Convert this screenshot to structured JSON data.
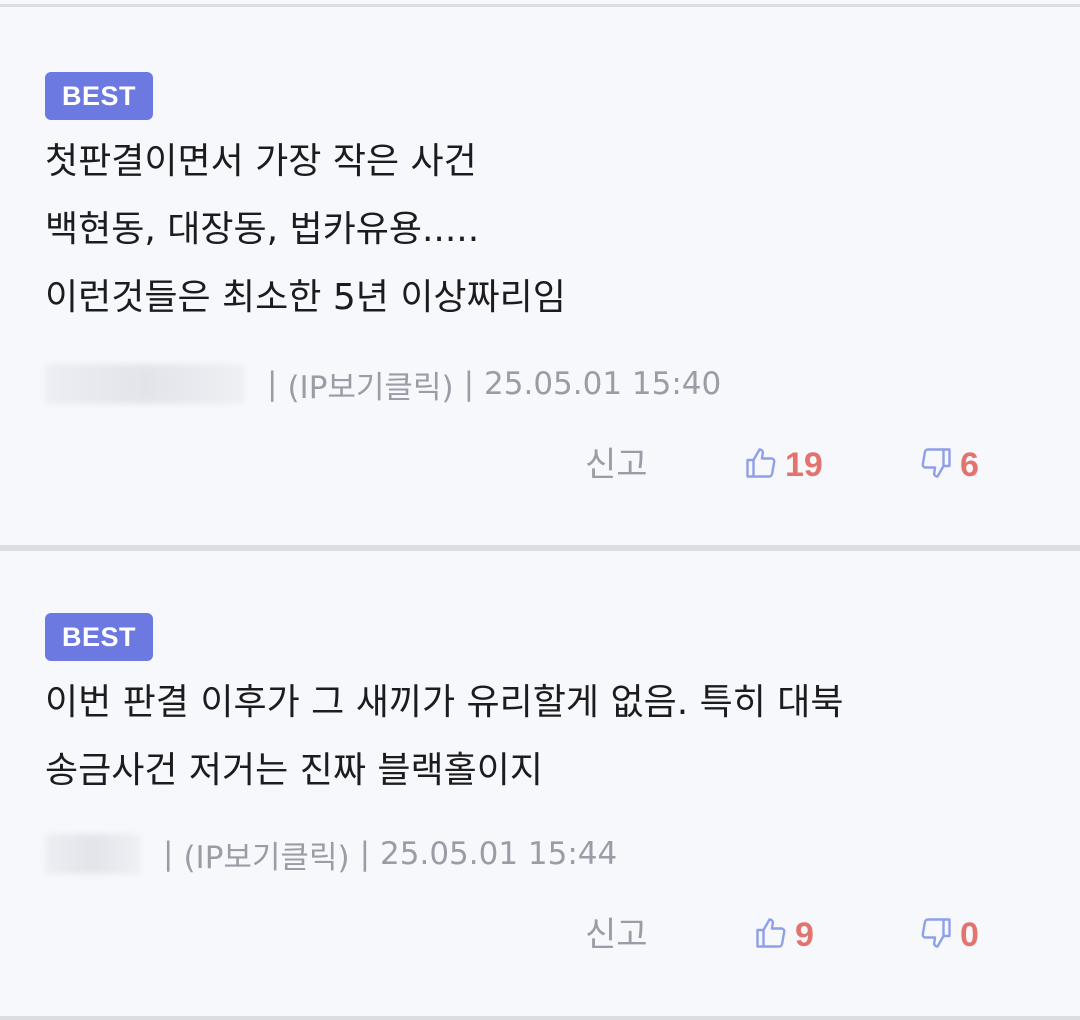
{
  "comments": [
    {
      "badge": "BEST",
      "lines": [
        "첫판결이면서 가장 작은 사건",
        "백현동, 대장동, 법카유용.....",
        "이런것들은 최소한 5년 이상짜리임"
      ],
      "ip_label": "(IP보기클릭)",
      "timestamp": "25.05.01 15:40",
      "report_label": "신고",
      "likes": "19",
      "dislikes": "6"
    },
    {
      "badge": "BEST",
      "lines": [
        "이번 판결 이후가 그 새끼가 유리할게 없음. 특히 대북",
        "송금사건 저거는 진짜 블랙홀이지"
      ],
      "ip_label": "(IP보기클릭)",
      "timestamp": "25.05.01 15:44",
      "report_label": "신고",
      "likes": "9",
      "dislikes": "0"
    }
  ],
  "separator": "|",
  "icons": {
    "like": "thumbs-up-icon",
    "dislike": "thumbs-down-icon"
  },
  "colors": {
    "badge": "#6c79e0",
    "count": "#e3736f",
    "icon": "#8fa0e8",
    "meta": "#9a9ca6"
  }
}
